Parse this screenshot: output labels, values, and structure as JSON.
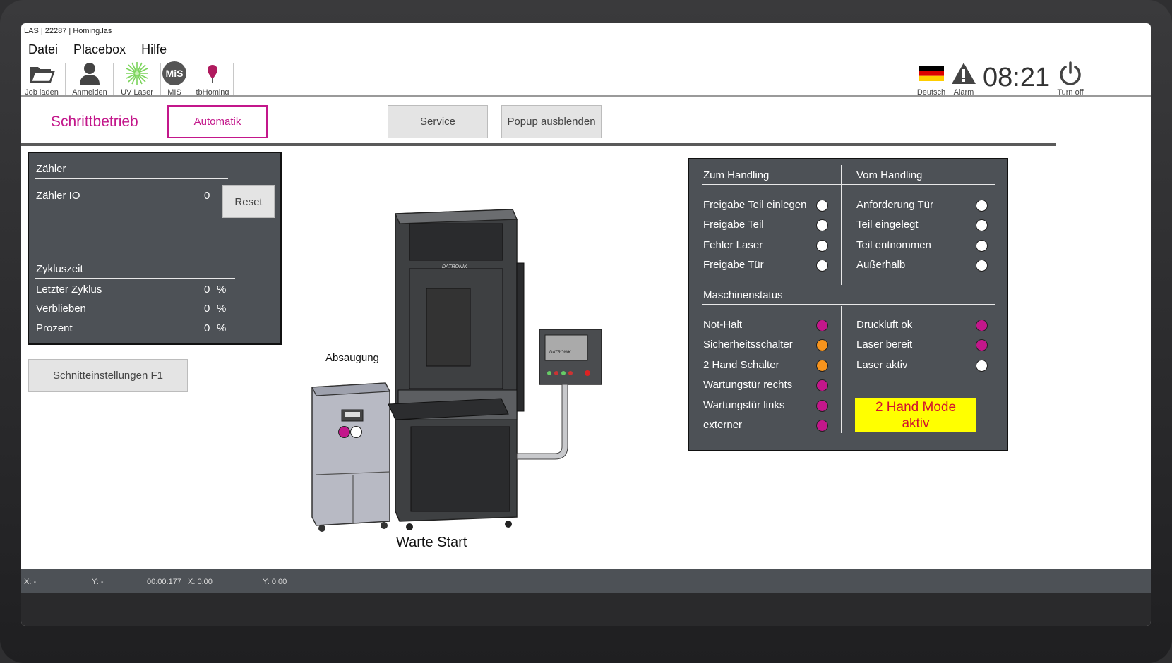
{
  "window": {
    "title": "LAS | 22287 | Homing.las"
  },
  "menu": {
    "items": [
      "Datei",
      "Placebox",
      "Hilfe"
    ]
  },
  "toolbar": {
    "job_laden": "Job laden",
    "anmelden": "Anmelden",
    "uv_laser": "UV Laser",
    "mis": "MIS",
    "tbhoming": "tbHoming",
    "deutsch": "Deutsch",
    "alarm": "Alarm",
    "turn_off": "Turn off",
    "clock": "08:21"
  },
  "mode": {
    "title": "Schrittbetrieb",
    "automatik": "Automatik",
    "service": "Service",
    "popup_ausblenden": "Popup ausblenden"
  },
  "counter_panel": {
    "zaehler_title": "Zähler",
    "zaehler_io_label": "Zähler IO",
    "zaehler_io_value": "0",
    "reset": "Reset",
    "zykluszeit_title": "Zykluszeit",
    "rows": [
      {
        "label": "Letzter Zyklus",
        "value": "0",
        "unit": "%"
      },
      {
        "label": "Verblieben",
        "value": "0",
        "unit": "%"
      },
      {
        "label": "Prozent",
        "value": "0",
        "unit": "%"
      }
    ]
  },
  "schnitt_button": "Schnitteinstellungen F1",
  "machine": {
    "absaugung": "Absaugung",
    "brand": "DATRONIK",
    "status_text": "Warte Start"
  },
  "handling_panel": {
    "zum_handling": "Zum Handling",
    "vom_handling": "Vom Handling",
    "zum_items": [
      {
        "label": "Freigabe Teil einlegen",
        "state": "white"
      },
      {
        "label": "Freigabe Teil",
        "state": "white"
      },
      {
        "label": "Fehler Laser",
        "state": "white"
      },
      {
        "label": "Freigabe Tür",
        "state": "white"
      }
    ],
    "vom_items": [
      {
        "label": "Anforderung Tür",
        "state": "white"
      },
      {
        "label": "Teil eingelegt",
        "state": "white"
      },
      {
        "label": "Teil entnommen",
        "state": "white"
      },
      {
        "label": "Außerhalb",
        "state": "white"
      }
    ],
    "maschinenstatus": "Maschinenstatus",
    "status_left": [
      {
        "label": "Not-Halt",
        "state": "magenta"
      },
      {
        "label": "Sicherheitsschalter",
        "state": "orange"
      },
      {
        "label": "2 Hand Schalter",
        "state": "orange"
      },
      {
        "label": "Wartungstür rechts",
        "state": "magenta"
      },
      {
        "label": "Wartungstür links",
        "state": "magenta"
      },
      {
        "label": "externer",
        "state": "magenta"
      }
    ],
    "status_right": [
      {
        "label": "Druckluft ok",
        "state": "magenta"
      },
      {
        "label": "Laser bereit",
        "state": "magenta"
      },
      {
        "label": "Laser aktiv",
        "state": "white"
      }
    ],
    "two_hand_line1": "2 Hand Mode",
    "two_hand_line2": "aktiv"
  },
  "statusbar": {
    "x1": "X: -",
    "y1": "Y: -",
    "time": "00:00:177",
    "x2": "X: 0.00",
    "y2": "Y: 0.00"
  },
  "colors": {
    "accent": "#c3178b",
    "orange": "#f7941d",
    "panel": "#4d5156",
    "warning": "#ffff00"
  }
}
